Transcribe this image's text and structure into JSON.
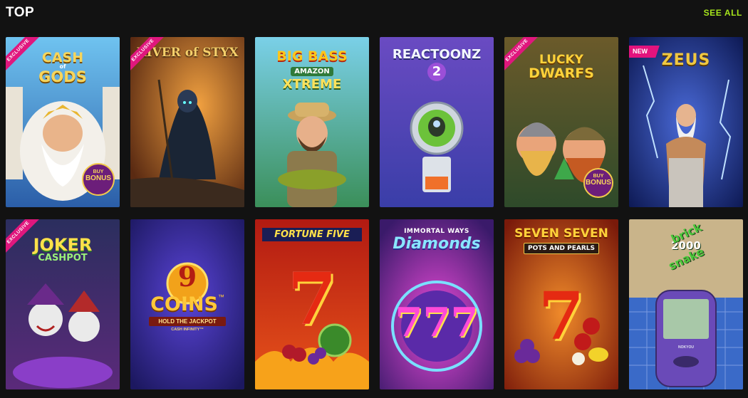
{
  "header": {
    "title": "TOP",
    "see_all": "SEE ALL"
  },
  "games": [
    {
      "title_line1": "CASH",
      "title_line2": "of",
      "title_line3": "GODS",
      "badge": "EXCLUSIVE",
      "buy_bonus_line1": "BUY",
      "buy_bonus_line2": "BONUS"
    },
    {
      "title": "RIVER of STYX",
      "badge": "EXCLUSIVE"
    },
    {
      "title_line1": "BIG BASS",
      "title_line2": "AMAZON",
      "title_line3": "XTREME"
    },
    {
      "title": "REACTOONZ",
      "numeral": "2"
    },
    {
      "title_line1": "LUCKY",
      "title_line2": "DWARFS",
      "badge": "EXCLUSIVE",
      "buy_bonus_line1": "BUY",
      "buy_bonus_line2": "BONUS"
    },
    {
      "title": "ZEUS",
      "badge": "NEW"
    },
    {
      "title_line1": "JOKER",
      "title_line2": "CASHPOT",
      "badge": "EXCLUSIVE"
    },
    {
      "numeral": "9",
      "title": "COINS",
      "tm": "™",
      "subtitle": "HOLD THE JACKPOT",
      "sub2": "CASH INFINITY™"
    },
    {
      "title": "FORTUNE FIVE",
      "numeral": "7"
    },
    {
      "title_line1": "IMMORTAL WAYS",
      "title_line2": "Diamonds",
      "numeral": "777"
    },
    {
      "title_line1": "SEVEN SEVEN",
      "title_line2": "POTS AND PEARLS",
      "numeral": "7"
    },
    {
      "title_line1": "brick",
      "title_line2": "2000",
      "title_line3": "snake",
      "device_brand": "NOKYOU"
    }
  ]
}
